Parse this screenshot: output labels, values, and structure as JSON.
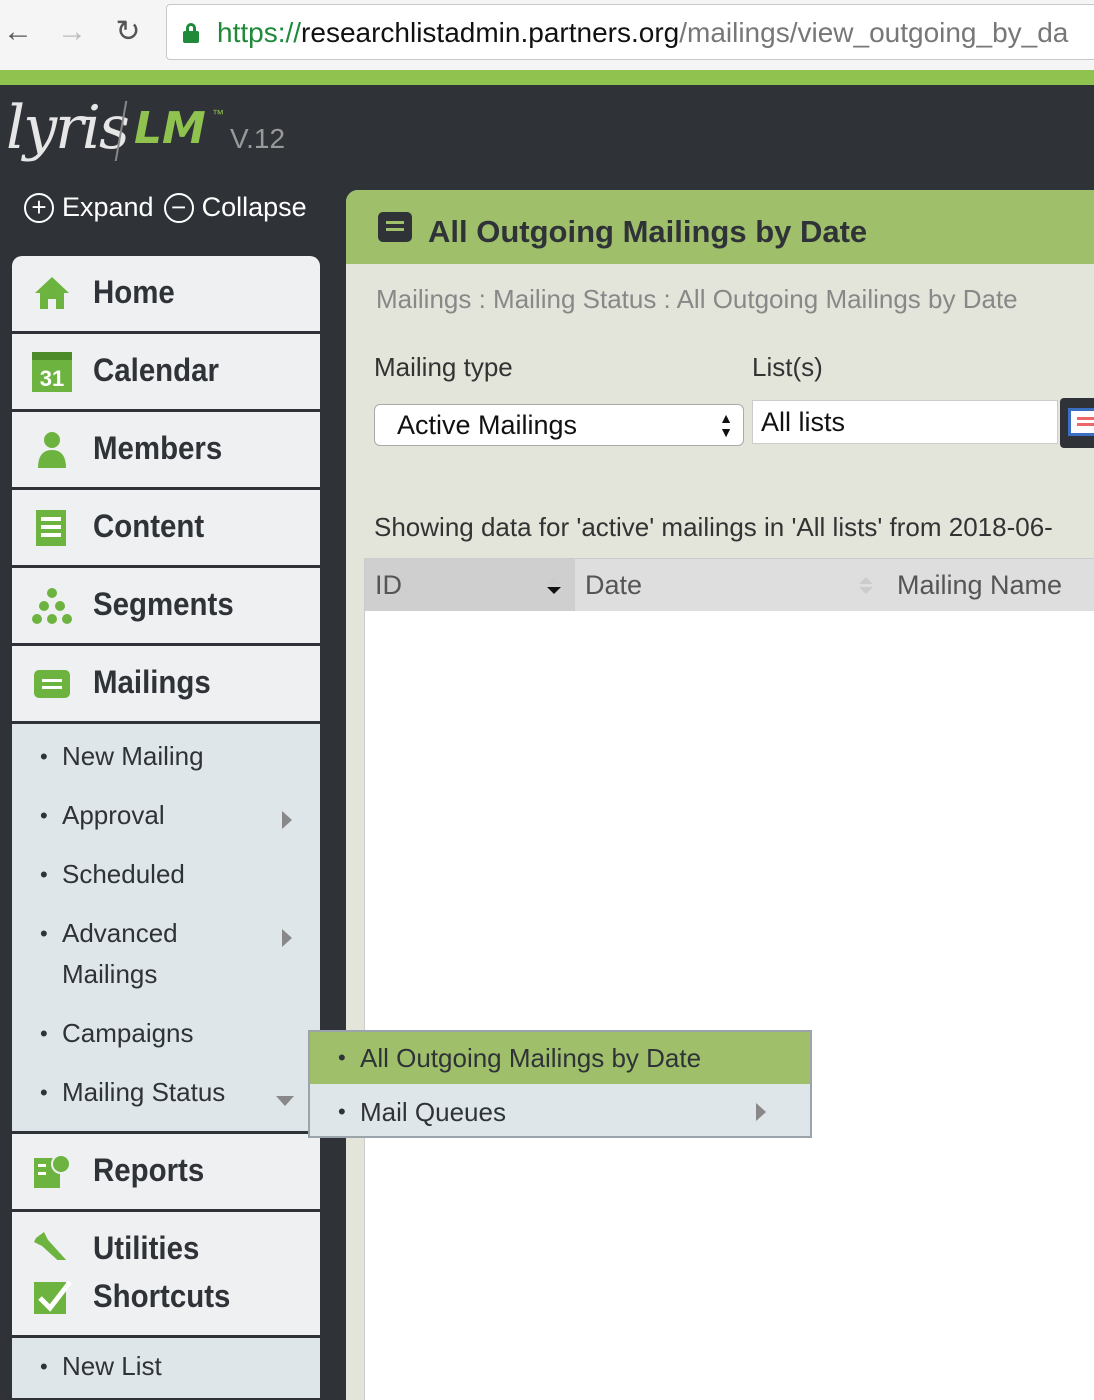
{
  "browser": {
    "url_scheme": "https://",
    "url_host": "researchlistadmin.partners.org",
    "url_path": "/mailings/view_outgoing_by_da"
  },
  "app": {
    "logo_text": "lyris",
    "logo_product": "LM",
    "logo_tm": "™",
    "version": "V.12",
    "accent_color": "#8fc24f"
  },
  "sidebar_controls": {
    "expand": "Expand",
    "collapse": "Collapse"
  },
  "nav": {
    "home": "Home",
    "calendar": "Calendar",
    "calendar_day": "31",
    "members": "Members",
    "content": "Content",
    "segments": "Segments",
    "mailings": "Mailings",
    "reports": "Reports",
    "utilities": "Utilities"
  },
  "mailings_sub": {
    "new_mailing": "New Mailing",
    "approval": "Approval",
    "scheduled": "Scheduled",
    "advanced_1": "Advanced",
    "advanced_2": "Mailings",
    "campaigns": "Campaigns",
    "mailing_status": "Mailing Status"
  },
  "flyout": {
    "all_outgoing": "All Outgoing Mailings by Date",
    "mail_queues": "Mail Queues"
  },
  "shortcuts": {
    "title": "Shortcuts",
    "new_list": "New List"
  },
  "main": {
    "title": "All Outgoing Mailings by Date",
    "breadcrumb": "Mailings : Mailing Status : All Outgoing Mailings by Date",
    "mailing_type_label": "Mailing type",
    "mailing_type_value": "Active Mailings",
    "lists_label": "List(s)",
    "lists_value": "All lists",
    "info": "Showing data for 'active' mailings in 'All lists' from 2018-06-"
  },
  "table": {
    "columns": [
      "ID",
      "Date",
      "Mailing Name"
    ]
  }
}
